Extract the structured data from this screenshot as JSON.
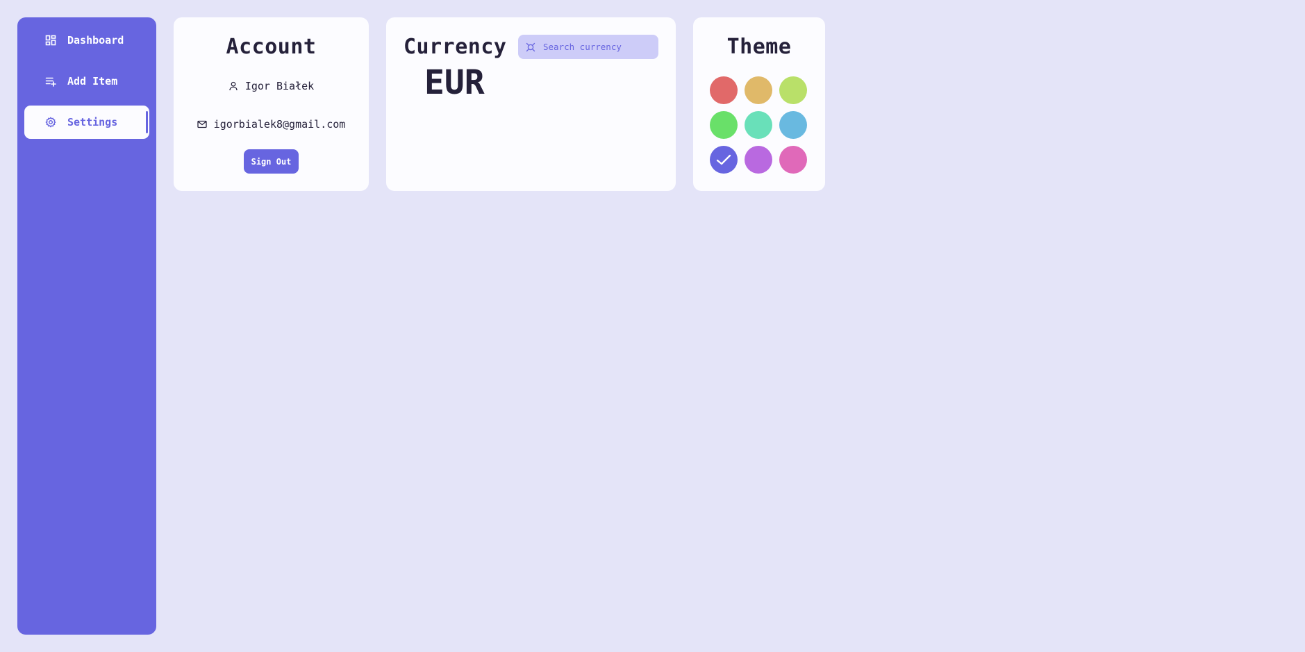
{
  "sidebar": {
    "items": [
      {
        "label": "Dashboard",
        "icon": "dashboard-icon",
        "active": false
      },
      {
        "label": "Add Item",
        "icon": "add-item-icon",
        "active": false
      },
      {
        "label": "Settings",
        "icon": "gear-icon",
        "active": true
      }
    ]
  },
  "account": {
    "title": "Account",
    "name": "Igor Białek",
    "email": "igorbialek8@gmail.com",
    "sign_out_label": "Sign Out"
  },
  "currency": {
    "title": "Currency",
    "value": "EUR",
    "search": {
      "value": "",
      "placeholder": "Search currency",
      "icon": "currency-icon"
    }
  },
  "theme": {
    "title": "Theme",
    "swatches": [
      {
        "name": "red",
        "color": "#e16969"
      },
      {
        "name": "orange",
        "color": "#e0b969"
      },
      {
        "name": "lime",
        "color": "#b9e069"
      },
      {
        "name": "green",
        "color": "#69e069"
      },
      {
        "name": "teal",
        "color": "#69e0b9"
      },
      {
        "name": "blue",
        "color": "#69b9e0"
      },
      {
        "name": "indigo",
        "color": "#6765e0",
        "selected": true
      },
      {
        "name": "purple",
        "color": "#b969e0"
      },
      {
        "name": "pink",
        "color": "#e069b9"
      }
    ]
  },
  "colors": {
    "accent": "#6765e0",
    "background": "#e4e4f8",
    "card": "#fcfcff",
    "search_bg": "#cdccf8"
  }
}
